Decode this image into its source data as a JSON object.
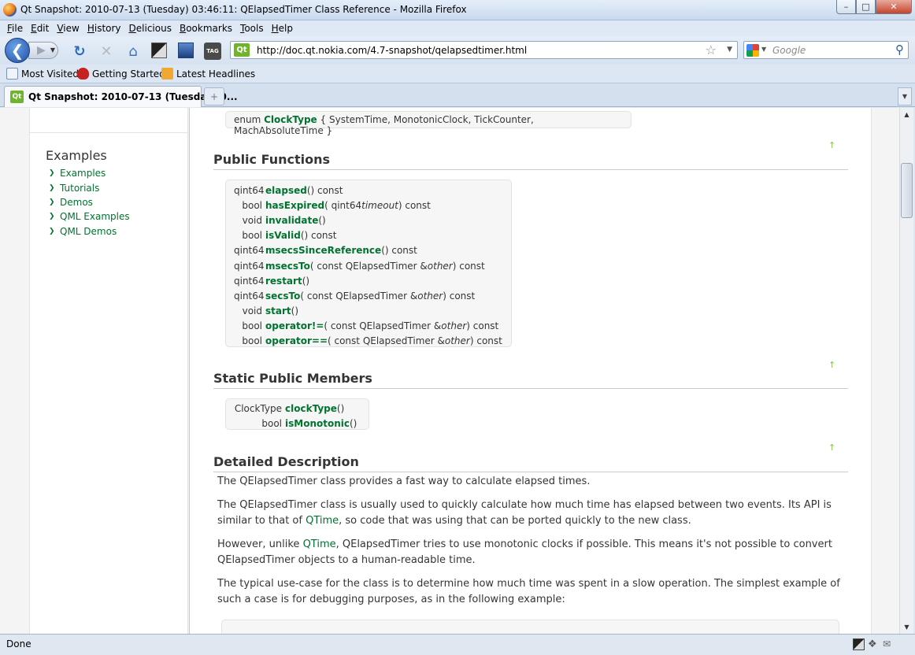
{
  "window": {
    "title": "Qt Snapshot: 2010-07-13 (Tuesday) 03:46:11: QElapsedTimer Class Reference - Mozilla Firefox",
    "minimize": "–",
    "maximize": "□",
    "close": "✕"
  },
  "menu": [
    "File",
    "Edit",
    "View",
    "History",
    "Delicious",
    "Bookmarks",
    "Tools",
    "Help"
  ],
  "toolbar": {
    "url": "http://doc.qt.nokia.com/4.7-snapshot/qelapsedtimer.html",
    "site_badge": "Qt",
    "search_engine": "Google",
    "tag_icon_text": "TAG"
  },
  "bookmarks": [
    "Most Visited",
    "Getting Started",
    "Latest Headlines"
  ],
  "tab": {
    "label": "Qt Snapshot: 2010-07-13 (Tuesday) 0...",
    "badge": "Qt",
    "new_tab": "+"
  },
  "sidebar": {
    "heading": "Examples",
    "items": [
      "Examples",
      "Tutorials",
      "Demos",
      "QML Examples",
      "QML Demos"
    ]
  },
  "content": {
    "enum": {
      "prefix": "enum",
      "name": "ClockType",
      "values": "{ SystemTime, MonotonicClock, TickCounter, MachAbsoluteTime }"
    },
    "public_functions_heading": "Public Functions",
    "functions": [
      {
        "ret": "qint64",
        "name": "elapsed",
        "args_pre": " () const",
        "param": "",
        "args_post": ""
      },
      {
        "ret": "bool",
        "name": "hasExpired",
        "args_pre": " ( qint64 ",
        "param": "timeout",
        "args_post": " ) const"
      },
      {
        "ret": "void",
        "name": "invalidate",
        "args_pre": " ()",
        "param": "",
        "args_post": ""
      },
      {
        "ret": "bool",
        "name": "isValid",
        "args_pre": " () const",
        "param": "",
        "args_post": ""
      },
      {
        "ret": "qint64",
        "name": "msecsSinceReference",
        "args_pre": " () const",
        "param": "",
        "args_post": ""
      },
      {
        "ret": "qint64",
        "name": "msecsTo",
        "args_pre": " ( const QElapsedTimer & ",
        "param": "other",
        "args_post": " ) const"
      },
      {
        "ret": "qint64",
        "name": "restart",
        "args_pre": " ()",
        "param": "",
        "args_post": ""
      },
      {
        "ret": "qint64",
        "name": "secsTo",
        "args_pre": " ( const QElapsedTimer & ",
        "param": "other",
        "args_post": " ) const"
      },
      {
        "ret": "void",
        "name": "start",
        "args_pre": " ()",
        "param": "",
        "args_post": ""
      },
      {
        "ret": "bool",
        "name": "operator!=",
        "args_pre": " ( const QElapsedTimer & ",
        "param": "other",
        "args_post": " ) const"
      },
      {
        "ret": "bool",
        "name": "operator==",
        "args_pre": " ( const QElapsedTimer & ",
        "param": "other",
        "args_post": " ) const"
      }
    ],
    "static_members_heading": "Static Public Members",
    "static_members": [
      {
        "ret": "ClockType",
        "name": "clockType",
        "args_pre": " ()",
        "param": "",
        "args_post": ""
      },
      {
        "ret": "bool",
        "name": "isMonotonic",
        "args_pre": " ()",
        "param": "",
        "args_post": ""
      }
    ],
    "detailed_heading": "Detailed Description",
    "up_arrow": "↑",
    "paragraphs": {
      "p1": "The QElapsedTimer class provides a fast way to calculate elapsed times.",
      "p2_a": "The QElapsedTimer class is usually used to quickly calculate how much time has elapsed between two events. Its API is similar to that of ",
      "p2_link": "QTime",
      "p2_b": ", so code that was using that can be ported quickly to the new class.",
      "p3_a": "However, unlike ",
      "p3_link": "QTime",
      "p3_b": ", QElapsedTimer tries to use monotonic clocks if possible. This means it's not possible to convert QElapsedTimer objects to a human-readable time.",
      "p4": "The typical use-case for the class is to determine how much time was spent in a slow operation. The simplest example of such a case is for debugging purposes, as in the following example:"
    }
  },
  "status": {
    "text": "Done"
  },
  "colors": {
    "link_green": "#00732f",
    "heading": "#363534"
  }
}
